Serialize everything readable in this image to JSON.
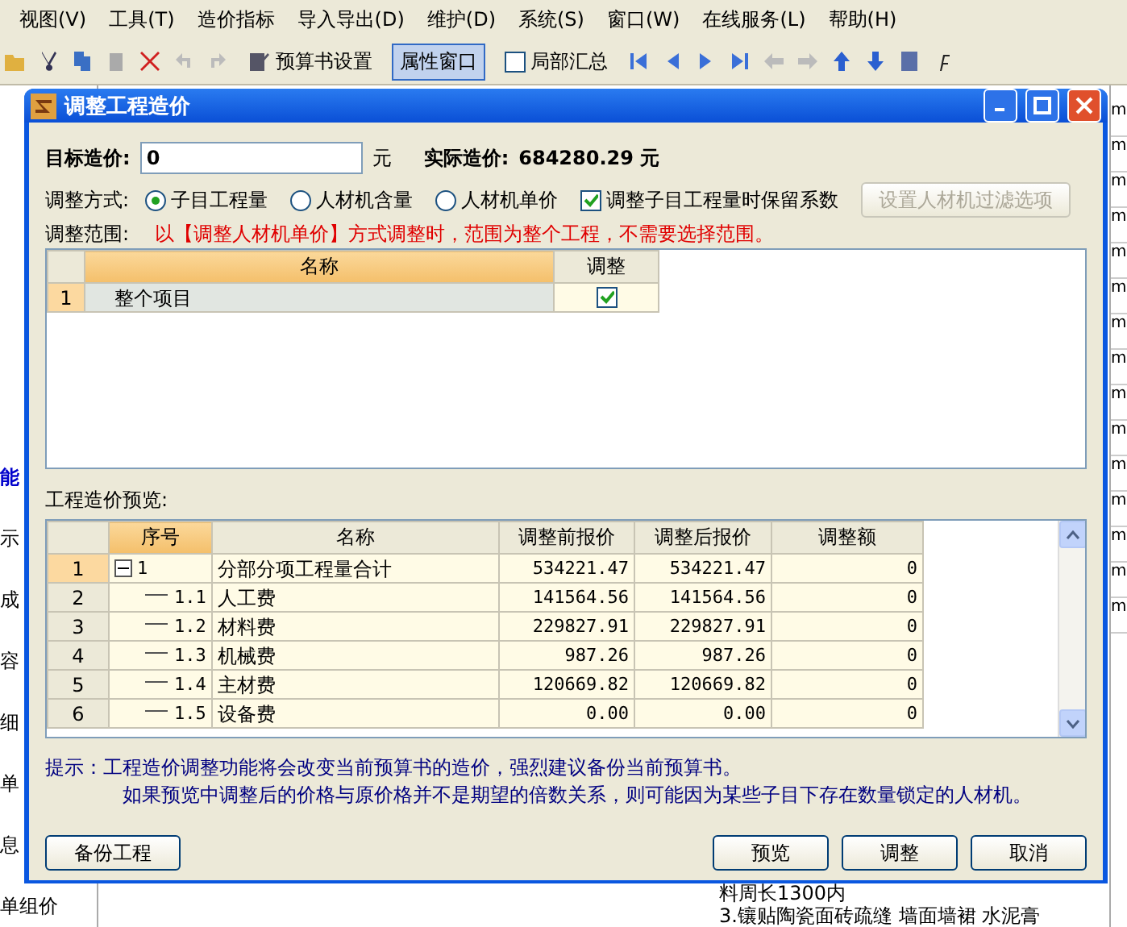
{
  "menu": [
    "视图(V)",
    "工具(T)",
    "造价指标",
    "导入导出(D)",
    "维护(D)",
    "系统(S)",
    "窗口(W)",
    "在线服务(L)",
    "帮助(H)"
  ],
  "toolbar": {
    "budget_settings": "预算书设置",
    "property_window": {
      "label": "属性窗口",
      "selected": true
    },
    "partial_summary": {
      "label": "局部汇总",
      "checked": false
    }
  },
  "background": {
    "left_texts": [
      {
        "text": "能",
        "kind": "link"
      },
      {
        "text": "示",
        "kind": "plain"
      },
      {
        "text": "成",
        "kind": "plain"
      },
      {
        "text": "容",
        "kind": "plain"
      },
      {
        "text": "细",
        "kind": "plain"
      },
      {
        "text": "单",
        "kind": "plain"
      },
      {
        "text": "息",
        "kind": "plain"
      },
      {
        "text": "单组价",
        "kind": "plain"
      }
    ],
    "right_cells": [
      "m",
      "m",
      "m",
      "m",
      "m",
      "m",
      "m",
      "m",
      "m",
      "m",
      "m",
      "m",
      "m",
      "m",
      "m"
    ],
    "bottom_texts": [
      "料周长1300内",
      "3.镶贴陶瓷面砖疏缝 墙面墙裙 水泥膏"
    ]
  },
  "dialog": {
    "title": "调整工程造价",
    "target_label": "目标造价:",
    "target_value": "0",
    "unit": "元",
    "actual_label": "实际造价:",
    "actual_value": "684280.29 元",
    "method_label": "调整方式:",
    "methods": [
      {
        "label": "子目工程量",
        "selected": true
      },
      {
        "label": "人材机含量",
        "selected": false
      },
      {
        "label": "人材机单价",
        "selected": false
      }
    ],
    "keep_coefficient": {
      "label": "调整子目工程量时保留系数",
      "checked": true
    },
    "filter_button": {
      "label": "设置人材机过滤选项",
      "disabled": true
    },
    "range_label": "调整范围:",
    "range_note": "以【调整人材机单价】方式调整时，范围为整个工程，不需要选择范围。",
    "range_table": {
      "columns": [
        "名称",
        "调整"
      ],
      "rows": [
        {
          "index": "1",
          "name": "整个项目",
          "checked": true
        }
      ]
    },
    "preview_label": "工程造价预览:",
    "preview_table": {
      "columns": [
        "序号",
        "名称",
        "调整前报价",
        "调整后报价",
        "调整额"
      ],
      "rows": [
        {
          "index": "1",
          "code": "1",
          "name": "分部分项工程量合计",
          "before": "534221.47",
          "after": "534221.47",
          "diff": "0",
          "expanded": true,
          "selected": true,
          "children": [
            {
              "index": "2",
              "code": "1.1",
              "name": "人工费",
              "before": "141564.56",
              "after": "141564.56",
              "diff": "0",
              "selected": false
            },
            {
              "index": "3",
              "code": "1.2",
              "name": "材料费",
              "before": "229827.91",
              "after": "229827.91",
              "diff": "0",
              "selected": false
            },
            {
              "index": "4",
              "code": "1.3",
              "name": "机械费",
              "before": "987.26",
              "after": "987.26",
              "diff": "0",
              "selected": false
            },
            {
              "index": "5",
              "code": "1.4",
              "name": "主材费",
              "before": "120669.82",
              "after": "120669.82",
              "diff": "0",
              "selected": false
            },
            {
              "index": "6",
              "code": "1.5",
              "name": "设备费",
              "before": "0.00",
              "after": "0.00",
              "diff": "0",
              "selected": false
            }
          ]
        }
      ]
    },
    "hint_label": "提示：",
    "hints": [
      "工程造价调整功能将会改变当前预算书的造价，强烈建议备份当前预算书。",
      "如果预览中调整后的价格与原价格并不是期望的倍数关系，则可能因为某些子目下存在数量锁定的人材机。"
    ],
    "backup_button": "备份工程",
    "buttons": [
      "预览",
      "调整",
      "取消"
    ]
  }
}
